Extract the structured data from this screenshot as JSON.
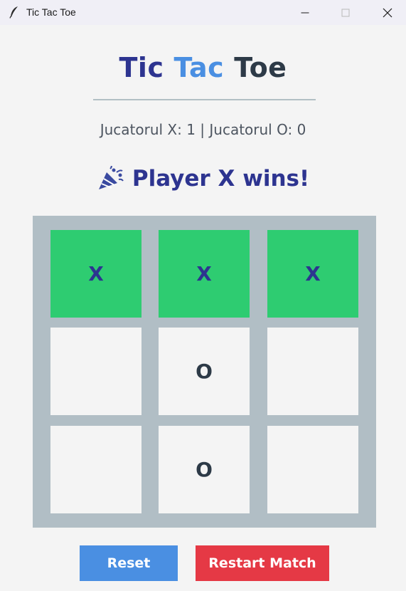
{
  "window": {
    "title": "Tic Tac Toe",
    "icon": "feather-icon"
  },
  "heading": {
    "word1": "Tic",
    "word2": "Tac",
    "word3": "Toe"
  },
  "score_text": "Jucatorul X: 1 | Jucatorul O: 0",
  "status": {
    "icon": "party-popper-icon",
    "text": "Player X wins!"
  },
  "board": {
    "cells": [
      [
        "X",
        "X",
        "X"
      ],
      [
        "",
        "O",
        ""
      ],
      [
        "",
        "O",
        ""
      ]
    ],
    "winning_row": 0
  },
  "buttons": {
    "reset": "Reset",
    "restart": "Restart Match"
  },
  "colors": {
    "accent_blue": "#4a8fe2",
    "navy": "#2d3490",
    "win_green": "#2ecc71",
    "danger_red": "#e53945",
    "board_gray": "#b1bec5"
  }
}
